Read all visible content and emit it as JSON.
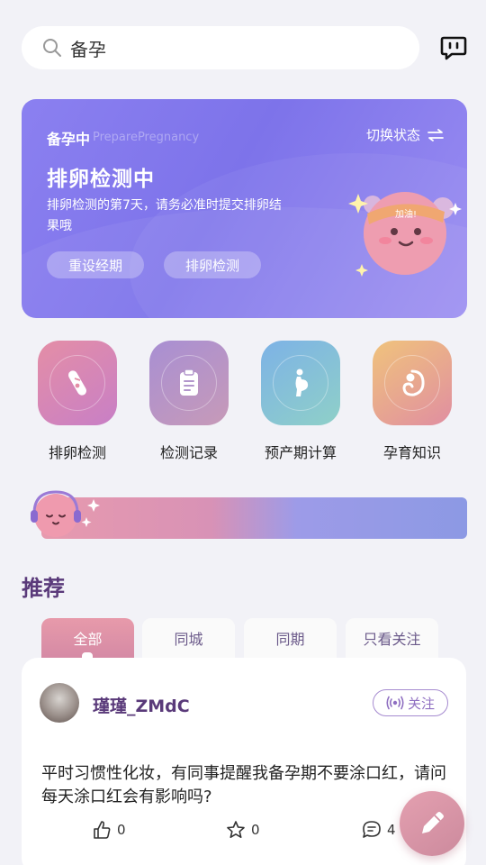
{
  "search": {
    "query": "备孕"
  },
  "hero": {
    "status": "备孕中",
    "status_en": "PreparePregnancy",
    "switch_label": "切换状态",
    "title": "排卵检测中",
    "desc": "排卵检测的第7天，请务必准时提交排卵结果哦",
    "btn_reset": "重设经期",
    "btn_detect": "排卵检测",
    "mascot_badge": "加油!"
  },
  "tools": [
    {
      "label": "排卵检测",
      "icon": "test-strip-icon"
    },
    {
      "label": "检测记录",
      "icon": "clipboard-icon"
    },
    {
      "label": "预产期计算",
      "icon": "pregnant-figure-icon"
    },
    {
      "label": "孕育知识",
      "icon": "fetus-icon"
    }
  ],
  "recommend": {
    "title": "推荐",
    "tabs": [
      "全部",
      "同城",
      "同期",
      "只看关注"
    ],
    "active_tab": "全部"
  },
  "post": {
    "author": "瑾瑾_ZMdC",
    "follow_label": "关注",
    "text": "平时习惯性化妆，有同事提醒我备孕期不要涂口红，请问每天涂口红会有影响吗?",
    "likes": "0",
    "favorites": "0",
    "comments": "4"
  },
  "colors": {
    "hero_bg": "#8b80f0",
    "accent_purple": "#5a3a7a",
    "accent_pink": "#e79aaa"
  }
}
